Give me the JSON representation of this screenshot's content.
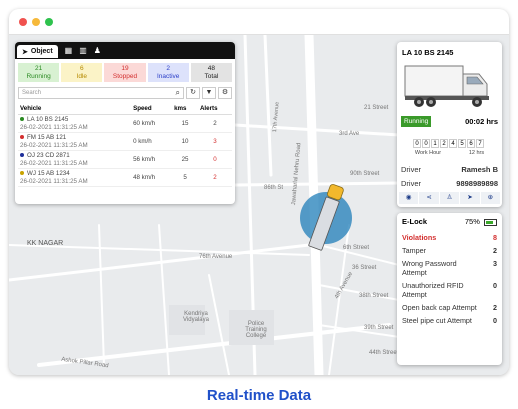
{
  "window": {
    "dots": [
      "#f0524f",
      "#f6b93b",
      "#2ec24d"
    ]
  },
  "map": {
    "labels": {
      "street_21": "21 Street",
      "third_ave": "3rd Ave",
      "jawaharlal": "Jawaharlal Nehru Road",
      "seventeenth": "17th Avenue",
      "ninetieth": "90th Street",
      "eightysixth": "86th St",
      "kk_nagar": "KK NAGAR",
      "seventy_sixth": "76th Avenue",
      "street_6": "6th Street",
      "street_36": "36 Street",
      "avenue_4th": "4th Avenue",
      "kendriya": "Kendriya Vidyalaya",
      "police": "Police Training College",
      "ashok": "Ashok Pillar Road",
      "street_38": "38th Street",
      "street_39": "39th Street",
      "street_44": "44th Street"
    }
  },
  "left_panel": {
    "tab_active": "Object",
    "tab_icons": [
      "list-icon",
      "grid-icon",
      "driver-icon"
    ],
    "stats": [
      {
        "value": "21",
        "label": "Running",
        "color": "#2a8a22",
        "bg": "#d8f1d2"
      },
      {
        "value": "6",
        "label": "Idle",
        "color": "#b58a00",
        "bg": "#fbf3c7"
      },
      {
        "value": "19",
        "label": "Stopped",
        "color": "#d32f2f",
        "bg": "#fbd9d7"
      },
      {
        "value": "2",
        "label": "Inactive",
        "color": "#2b3fc8",
        "bg": "#dde2fb"
      },
      {
        "value": "48",
        "label": "Total",
        "color": "#222222",
        "bg": "#e3e3e3"
      }
    ],
    "search_placeholder": "Search",
    "columns": [
      "Vehicle",
      "Speed",
      "kms",
      "Alerts"
    ],
    "rows": [
      {
        "vehicle": "LA 10 BS 2145",
        "time": "26-02-2021 11:31:25 AM",
        "speed": "60 km/h",
        "kms": "15",
        "alerts": "2",
        "dot": "#2a8a22",
        "alert_color": "#444444"
      },
      {
        "vehicle": "FM 15 AB 121",
        "time": "26-02-2021 11:31:25 AM",
        "speed": "0 km/h",
        "kms": "10",
        "alerts": "3",
        "dot": "#d32f2f",
        "alert_color": "#d32f2f"
      },
      {
        "vehicle": "OJ 23 CD 2871",
        "time": "26-02-2021 11:31:25 AM",
        "speed": "56 km/h",
        "kms": "25",
        "alerts": "0",
        "dot": "#1f2f9a",
        "alert_color": "#d32f2f"
      },
      {
        "vehicle": "WJ 15 AB 1234",
        "time": "26-02-2021 11:31:25 AM",
        "speed": "48 km/h",
        "kms": "5",
        "alerts": "2",
        "dot": "#c9a300",
        "alert_color": "#d32f2f"
      }
    ]
  },
  "vehicle_card": {
    "title": "LA 10 BS 2145",
    "status": "Running",
    "duration": "00:02 hrs",
    "odometer": [
      "0",
      "0",
      "1",
      "2",
      "4",
      "5",
      "6",
      "7"
    ],
    "work_hour_label": "Work Hour",
    "work_hour_value": "12 hrs",
    "driver_label": "Driver",
    "driver_name": "Ramesh B",
    "phone_label": "Driver",
    "phone": "9898989898",
    "action_icons": [
      "eye-icon",
      "share-icon",
      "person-icon",
      "navigate-icon",
      "zoom-icon"
    ]
  },
  "elock": {
    "title": "E-Lock",
    "battery": "75%",
    "battery_level": 0.75,
    "items": [
      {
        "label": "Violations",
        "value": "8",
        "color": "#d32f2f",
        "bold": true
      },
      {
        "label": "Tamper",
        "value": "2",
        "color": "#333333",
        "bold": false
      },
      {
        "label": "Wrong Password Attempt",
        "value": "3",
        "color": "#333333",
        "bold": false
      },
      {
        "label": "Unauthorized RFID Attempt",
        "value": "0",
        "color": "#333333",
        "bold": false
      },
      {
        "label": "Open back cap Attempt",
        "value": "2",
        "color": "#333333",
        "bold": false
      },
      {
        "label": "Steel pipe cut Attempt",
        "value": "0",
        "color": "#333333",
        "bold": false
      }
    ]
  },
  "caption": "Real-time Data"
}
